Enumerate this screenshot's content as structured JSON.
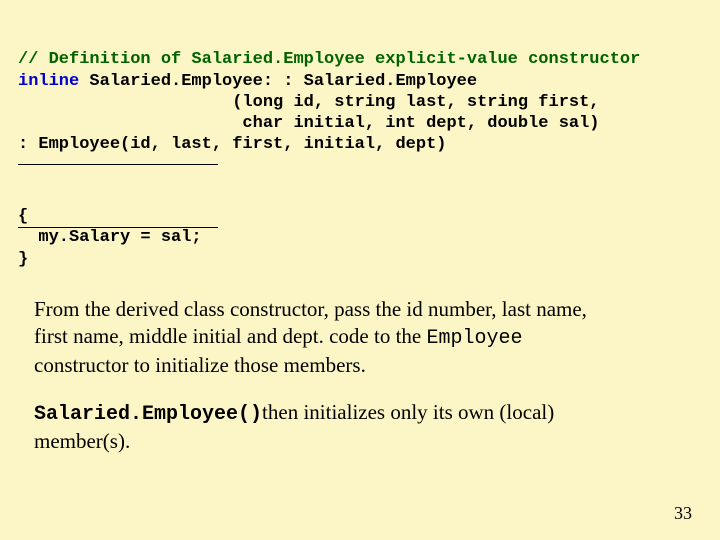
{
  "code": {
    "l1": "// Definition of Salaried.Employee explicit-value constructor",
    "l2a": "inline",
    "l2b": " Salaried.Employee: : Salaried.Employee",
    "l3": "                     (long id, string last, string first,",
    "l4": "                      char initial, int dept, double sal)",
    "l5": ": Employee(id, last, first, initial, dept)",
    "b1": "{",
    "b2": "  my.Salary = sal;",
    "b3": "}"
  },
  "para1": {
    "t1": "From the derived class constructor, pass the id number, last name,",
    "t2": "first name, middle initial and dept. code to the ",
    "mono": "Employee",
    "t3": "constructor to initialize those members."
  },
  "para2": {
    "mono": "Salaried.Employee()",
    "t1": "then initializes only its own (local)",
    "t2": "member(s)."
  },
  "pagenum": "33"
}
